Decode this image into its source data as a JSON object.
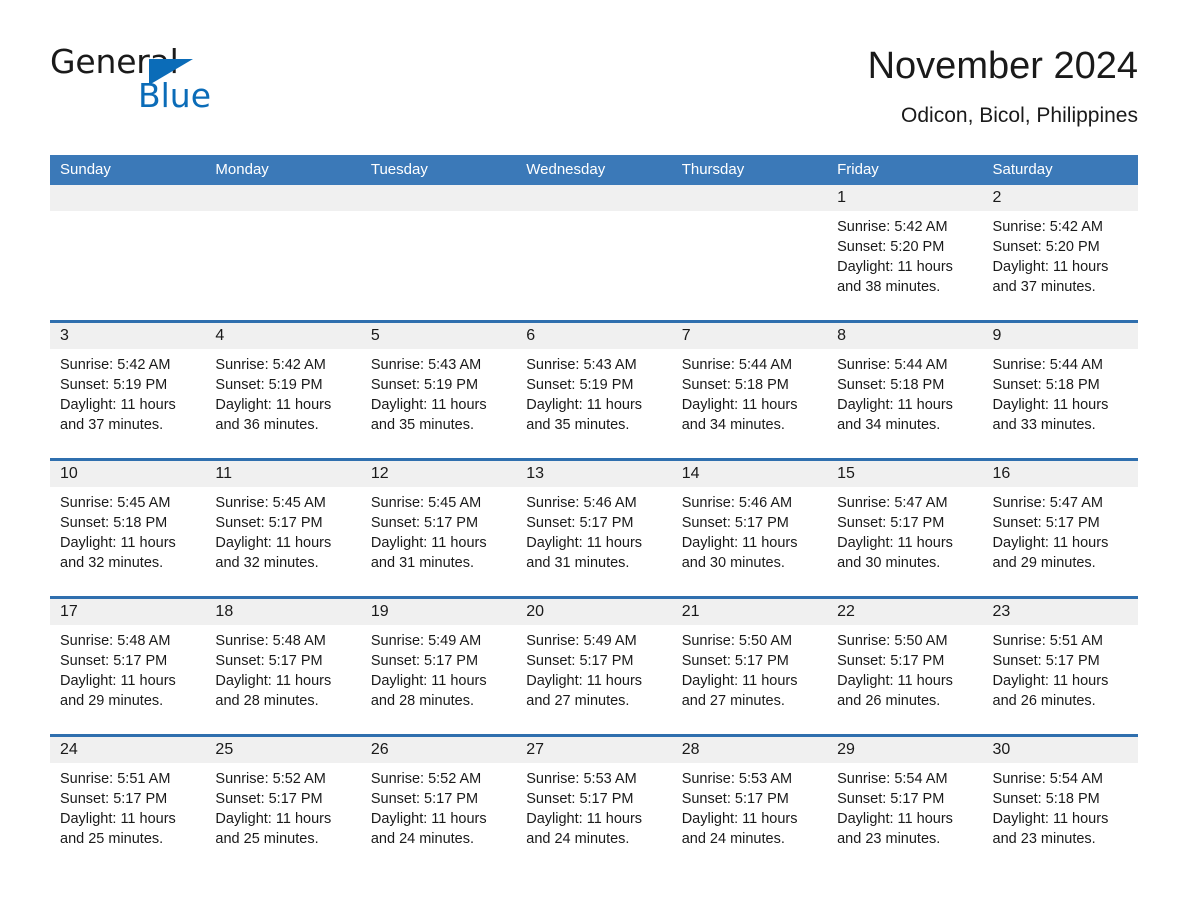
{
  "brand": {
    "word_general": "General",
    "word_blue": "Blue",
    "flag_icon": "triangle-flag-icon",
    "accent_color": "#0b6cb8"
  },
  "header": {
    "month_title": "November 2024",
    "location": "Odicon, Bicol, Philippines"
  },
  "calendar": {
    "header_bg": "#3b79b8",
    "row_divider": "#2f6fae",
    "daynum_bg": "#f0f0f0",
    "weekdays": [
      "Sunday",
      "Monday",
      "Tuesday",
      "Wednesday",
      "Thursday",
      "Friday",
      "Saturday"
    ],
    "weeks": [
      [
        {
          "day": "",
          "empty": true
        },
        {
          "day": "",
          "empty": true
        },
        {
          "day": "",
          "empty": true
        },
        {
          "day": "",
          "empty": true
        },
        {
          "day": "",
          "empty": true
        },
        {
          "day": "1",
          "sunrise": "Sunrise: 5:42 AM",
          "sunset": "Sunset: 5:20 PM",
          "daylight": "Daylight: 11 hours and 38 minutes."
        },
        {
          "day": "2",
          "sunrise": "Sunrise: 5:42 AM",
          "sunset": "Sunset: 5:20 PM",
          "daylight": "Daylight: 11 hours and 37 minutes."
        }
      ],
      [
        {
          "day": "3",
          "sunrise": "Sunrise: 5:42 AM",
          "sunset": "Sunset: 5:19 PM",
          "daylight": "Daylight: 11 hours and 37 minutes."
        },
        {
          "day": "4",
          "sunrise": "Sunrise: 5:42 AM",
          "sunset": "Sunset: 5:19 PM",
          "daylight": "Daylight: 11 hours and 36 minutes."
        },
        {
          "day": "5",
          "sunrise": "Sunrise: 5:43 AM",
          "sunset": "Sunset: 5:19 PM",
          "daylight": "Daylight: 11 hours and 35 minutes."
        },
        {
          "day": "6",
          "sunrise": "Sunrise: 5:43 AM",
          "sunset": "Sunset: 5:19 PM",
          "daylight": "Daylight: 11 hours and 35 minutes."
        },
        {
          "day": "7",
          "sunrise": "Sunrise: 5:44 AM",
          "sunset": "Sunset: 5:18 PM",
          "daylight": "Daylight: 11 hours and 34 minutes."
        },
        {
          "day": "8",
          "sunrise": "Sunrise: 5:44 AM",
          "sunset": "Sunset: 5:18 PM",
          "daylight": "Daylight: 11 hours and 34 minutes."
        },
        {
          "day": "9",
          "sunrise": "Sunrise: 5:44 AM",
          "sunset": "Sunset: 5:18 PM",
          "daylight": "Daylight: 11 hours and 33 minutes."
        }
      ],
      [
        {
          "day": "10",
          "sunrise": "Sunrise: 5:45 AM",
          "sunset": "Sunset: 5:18 PM",
          "daylight": "Daylight: 11 hours and 32 minutes."
        },
        {
          "day": "11",
          "sunrise": "Sunrise: 5:45 AM",
          "sunset": "Sunset: 5:17 PM",
          "daylight": "Daylight: 11 hours and 32 minutes."
        },
        {
          "day": "12",
          "sunrise": "Sunrise: 5:45 AM",
          "sunset": "Sunset: 5:17 PM",
          "daylight": "Daylight: 11 hours and 31 minutes."
        },
        {
          "day": "13",
          "sunrise": "Sunrise: 5:46 AM",
          "sunset": "Sunset: 5:17 PM",
          "daylight": "Daylight: 11 hours and 31 minutes."
        },
        {
          "day": "14",
          "sunrise": "Sunrise: 5:46 AM",
          "sunset": "Sunset: 5:17 PM",
          "daylight": "Daylight: 11 hours and 30 minutes."
        },
        {
          "day": "15",
          "sunrise": "Sunrise: 5:47 AM",
          "sunset": "Sunset: 5:17 PM",
          "daylight": "Daylight: 11 hours and 30 minutes."
        },
        {
          "day": "16",
          "sunrise": "Sunrise: 5:47 AM",
          "sunset": "Sunset: 5:17 PM",
          "daylight": "Daylight: 11 hours and 29 minutes."
        }
      ],
      [
        {
          "day": "17",
          "sunrise": "Sunrise: 5:48 AM",
          "sunset": "Sunset: 5:17 PM",
          "daylight": "Daylight: 11 hours and 29 minutes."
        },
        {
          "day": "18",
          "sunrise": "Sunrise: 5:48 AM",
          "sunset": "Sunset: 5:17 PM",
          "daylight": "Daylight: 11 hours and 28 minutes."
        },
        {
          "day": "19",
          "sunrise": "Sunrise: 5:49 AM",
          "sunset": "Sunset: 5:17 PM",
          "daylight": "Daylight: 11 hours and 28 minutes."
        },
        {
          "day": "20",
          "sunrise": "Sunrise: 5:49 AM",
          "sunset": "Sunset: 5:17 PM",
          "daylight": "Daylight: 11 hours and 27 minutes."
        },
        {
          "day": "21",
          "sunrise": "Sunrise: 5:50 AM",
          "sunset": "Sunset: 5:17 PM",
          "daylight": "Daylight: 11 hours and 27 minutes."
        },
        {
          "day": "22",
          "sunrise": "Sunrise: 5:50 AM",
          "sunset": "Sunset: 5:17 PM",
          "daylight": "Daylight: 11 hours and 26 minutes."
        },
        {
          "day": "23",
          "sunrise": "Sunrise: 5:51 AM",
          "sunset": "Sunset: 5:17 PM",
          "daylight": "Daylight: 11 hours and 26 minutes."
        }
      ],
      [
        {
          "day": "24",
          "sunrise": "Sunrise: 5:51 AM",
          "sunset": "Sunset: 5:17 PM",
          "daylight": "Daylight: 11 hours and 25 minutes."
        },
        {
          "day": "25",
          "sunrise": "Sunrise: 5:52 AM",
          "sunset": "Sunset: 5:17 PM",
          "daylight": "Daylight: 11 hours and 25 minutes."
        },
        {
          "day": "26",
          "sunrise": "Sunrise: 5:52 AM",
          "sunset": "Sunset: 5:17 PM",
          "daylight": "Daylight: 11 hours and 24 minutes."
        },
        {
          "day": "27",
          "sunrise": "Sunrise: 5:53 AM",
          "sunset": "Sunset: 5:17 PM",
          "daylight": "Daylight: 11 hours and 24 minutes."
        },
        {
          "day": "28",
          "sunrise": "Sunrise: 5:53 AM",
          "sunset": "Sunset: 5:17 PM",
          "daylight": "Daylight: 11 hours and 24 minutes."
        },
        {
          "day": "29",
          "sunrise": "Sunrise: 5:54 AM",
          "sunset": "Sunset: 5:17 PM",
          "daylight": "Daylight: 11 hours and 23 minutes."
        },
        {
          "day": "30",
          "sunrise": "Sunrise: 5:54 AM",
          "sunset": "Sunset: 5:18 PM",
          "daylight": "Daylight: 11 hours and 23 minutes."
        }
      ]
    ]
  }
}
